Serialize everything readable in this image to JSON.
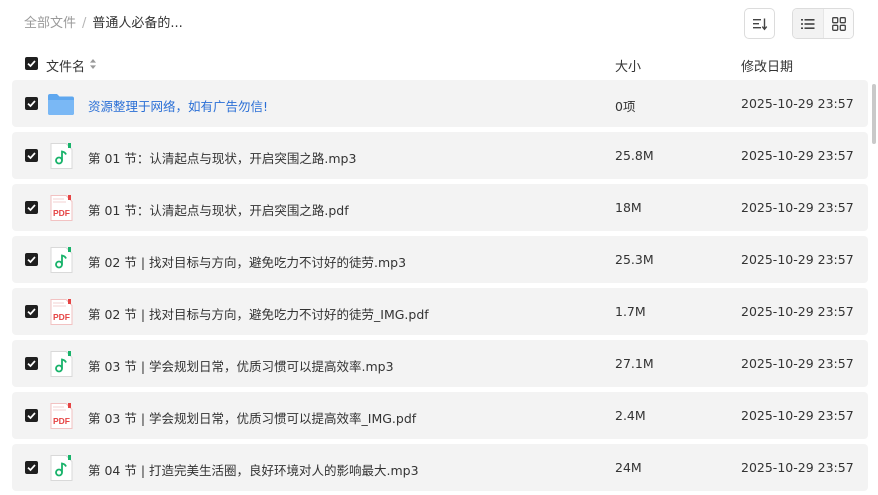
{
  "breadcrumb": {
    "root": "全部文件",
    "separator": "/",
    "current": "普通人必备的..."
  },
  "toolbar": {
    "sort_icon": "sort-icon",
    "list_view_icon": "list-view-icon",
    "grid_view_icon": "grid-view-icon",
    "active_view": "list"
  },
  "table": {
    "headers": {
      "name": "文件名",
      "size": "大小",
      "date": "修改日期"
    },
    "select_all_checked": true,
    "rows": [
      {
        "type": "folder",
        "name": "资源整理于网络，如有广告勿信!",
        "size": "0项",
        "date": "2025-10-29 23:57",
        "checked": true
      },
      {
        "type": "audio",
        "name": "第 01 节：认清起点与现状，开启突围之路.mp3",
        "size": "25.8M",
        "date": "2025-10-29 23:57",
        "checked": true
      },
      {
        "type": "pdf",
        "name": "第 01 节：认清起点与现状，开启突围之路.pdf",
        "size": "18M",
        "date": "2025-10-29 23:57",
        "checked": true
      },
      {
        "type": "audio",
        "name": "第 02 节 | 找对目标与方向，避免吃力不讨好的徒劳.mp3",
        "size": "25.3M",
        "date": "2025-10-29 23:57",
        "checked": true
      },
      {
        "type": "pdf",
        "name": "第 02 节 | 找对目标与方向，避免吃力不讨好的徒劳_IMG.pdf",
        "size": "1.7M",
        "date": "2025-10-29 23:57",
        "checked": true
      },
      {
        "type": "audio",
        "name": "第 03 节 | 学会规划日常，优质习惯可以提高效率.mp3",
        "size": "27.1M",
        "date": "2025-10-29 23:57",
        "checked": true
      },
      {
        "type": "pdf",
        "name": "第 03 节 | 学会规划日常，优质习惯可以提高效率_IMG.pdf",
        "size": "2.4M",
        "date": "2025-10-29 23:57",
        "checked": true
      },
      {
        "type": "audio",
        "name": "第 04 节 | 打造完美生活圈，良好环境对人的影响最大.mp3",
        "size": "24M",
        "date": "2025-10-29 23:57",
        "checked": true
      }
    ]
  },
  "icons": {
    "folder": "folder-icon",
    "audio": "music-file-icon",
    "pdf": "pdf-file-icon",
    "pdf_label": "PDF"
  },
  "colors": {
    "folder_link": "#2a6fd6",
    "row_bg": "#f3f3f3",
    "checkbox": "#1f1f1f",
    "audio_accent": "#19b36b",
    "pdf_accent": "#e64545",
    "folder_fill": "#5ea7ef"
  }
}
